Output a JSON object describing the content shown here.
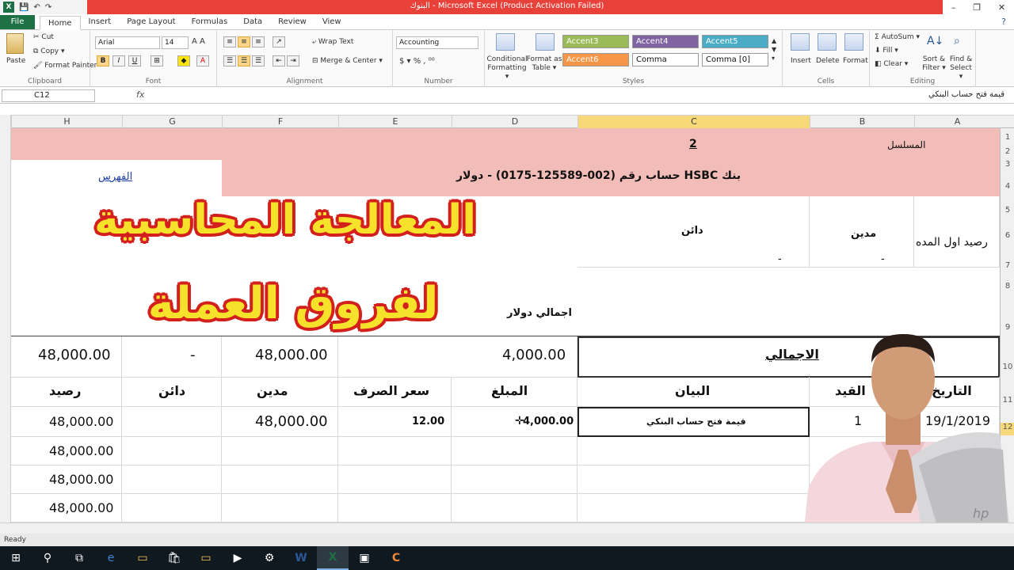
{
  "window": {
    "title": "البنوك  -  Microsoft Excel (Product Activation Failed)",
    "help_glyph": "?",
    "controls": [
      "–",
      "❐",
      "✕"
    ]
  },
  "ribbon_tabs": [
    "File",
    "Home",
    "Insert",
    "Page Layout",
    "Formulas",
    "Data",
    "Review",
    "View"
  ],
  "ribbon": {
    "clipboard": {
      "paste": "Paste",
      "cut": "Cut",
      "copy": "Copy ▾",
      "format_painter": "Format Painter",
      "label": "Clipboard"
    },
    "font": {
      "name": "Arial",
      "size": "14",
      "label": "Font"
    },
    "alignment": {
      "wrap": "Wrap Text",
      "merge": "Merge & Center ▾",
      "label": "Alignment"
    },
    "number": {
      "format": "Accounting",
      "label": "Number"
    },
    "styles": {
      "conditional": "Conditional Formatting ▾",
      "format_as_table": "Format as Table ▾",
      "cells": [
        {
          "name": "Accent3",
          "color": "#9bbb59"
        },
        {
          "name": "Accent4",
          "color": "#8064a2"
        },
        {
          "name": "Accent5",
          "color": "#4bacc6"
        },
        {
          "name": "Accent6",
          "color": "#f79646"
        },
        {
          "name": "Comma",
          "color": "#ffffff"
        },
        {
          "name": "Comma [0]",
          "color": "#ffffff"
        }
      ],
      "label": "Styles"
    },
    "cells": {
      "insert": "Insert",
      "delete": "Delete",
      "format": "Format",
      "label": "Cells"
    },
    "editing": {
      "autosum": "AutoSum ▾",
      "fill": "Fill ▾",
      "clear": "Clear ▾",
      "sort": "Sort & Filter ▾",
      "find": "Find & Select ▾",
      "label": "Editing"
    }
  },
  "formula_bar": {
    "name_box": "C12",
    "fx": "fx",
    "content": "قيمة فتح حساب البنكي"
  },
  "columns": [
    "H",
    "G",
    "F",
    "E",
    "D",
    "C",
    "B",
    "A"
  ],
  "rows": [
    "1",
    "2",
    "3",
    "4",
    "5",
    "6",
    "7",
    "8",
    "9",
    "10",
    "11",
    "12"
  ],
  "sheet": {
    "serial_label": "المسلسل",
    "serial_value": "2",
    "bank_title": "بنك HSBC حساب رقم (002-125589-0175) - دولار",
    "index_link": "الفهرس",
    "opening_balance": "رصيد اول المده",
    "debit": "مدين",
    "credit": "دائن",
    "dash": "-",
    "total_usd": "اجمالي دولار",
    "total_label": "الاجمالي",
    "totals": {
      "balance": "48,000.00",
      "credit": "-",
      "debit": "48,000.00",
      "amount": "4,000.00"
    },
    "headers": {
      "balance": "رصيد",
      "credit": "دائن",
      "debit": "مدين",
      "rate": "سعر الصرف",
      "amount": "المبلغ",
      "desc": "البيان",
      "entry": "القيد",
      "date": "التاريخ"
    },
    "row12": {
      "balance": "48,000.00",
      "debit": "48,000.00",
      "rate": "12.00",
      "amount": "4,000.00",
      "desc": "قيمة فتح حساب البنكي",
      "entry": "1",
      "date": "19/1/2019"
    },
    "running_balances": [
      "48,000.00",
      "48,000.00",
      "48,000.00"
    ]
  },
  "overlay": {
    "line1": "المعالجة المحاسبية",
    "line2": "لفروق العملة"
  },
  "status": "Ready",
  "colors": {
    "header_band": "#f2bcb8",
    "title_bar": "#e8413a",
    "excel_green": "#1e7145",
    "overlay_fill": "#f6e22a",
    "overlay_stroke": "#d3201d"
  }
}
